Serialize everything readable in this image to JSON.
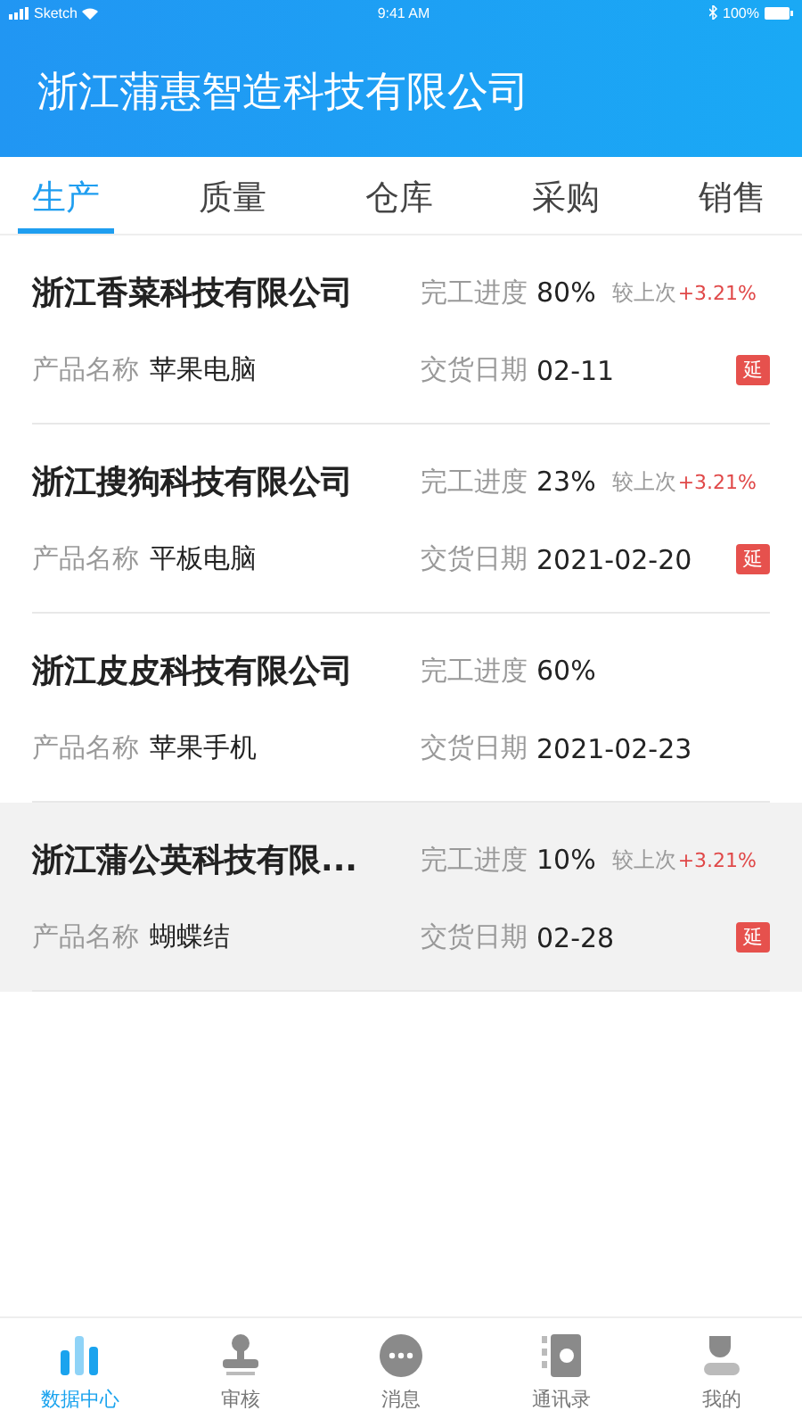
{
  "status_bar": {
    "carrier": "Sketch",
    "time": "9:41 AM",
    "battery": "100%"
  },
  "header": {
    "title": "浙江蒲惠智造科技有限公司"
  },
  "tabs": [
    {
      "label": "生产",
      "selected": true
    },
    {
      "label": "质量",
      "selected": false
    },
    {
      "label": "仓库",
      "selected": false
    },
    {
      "label": "采购",
      "selected": false
    },
    {
      "label": "销售",
      "selected": false
    }
  ],
  "orders": [
    {
      "company": "浙江香菜科技有限公司",
      "progress_label": "完工进度",
      "progress": "80%",
      "compare_label": "较上次",
      "change": "+3.21%",
      "product_label": "产品名称",
      "product": "苹果电脑",
      "date_label": "交货日期",
      "date": "02-11",
      "badge": "延",
      "selected": false
    },
    {
      "company": "浙江搜狗科技有限公司",
      "progress_label": "完工进度",
      "progress": "23%",
      "compare_label": "较上次",
      "change": "+3.21%",
      "product_label": "产品名称",
      "product": "平板电脑",
      "date_label": "交货日期",
      "date": "2021-02-20",
      "badge": "延",
      "selected": false
    },
    {
      "company": "浙江皮皮科技有限公司",
      "progress_label": "完工进度",
      "progress": "60%",
      "product_label": "产品名称",
      "product": "苹果手机",
      "date_label": "交货日期",
      "date": "2021-02-23",
      "selected": false
    },
    {
      "company": "浙江蒲公英科技有限...",
      "progress_label": "完工进度",
      "progress": "10%",
      "compare_label": "较上次",
      "change": "+3.21%",
      "product_label": "产品名称",
      "product": "蝴蝶结",
      "date_label": "交货日期",
      "date": "02-28",
      "badge": "延",
      "selected": true
    }
  ],
  "bottom_nav": [
    {
      "label": "数据中心",
      "kind": "chart",
      "selected": true
    },
    {
      "label": "审核",
      "kind": "stamp",
      "selected": false
    },
    {
      "label": "消息",
      "kind": "message",
      "selected": false
    },
    {
      "label": "通讯录",
      "kind": "contacts",
      "selected": false
    },
    {
      "label": "我的",
      "kind": "profile",
      "selected": false
    }
  ]
}
